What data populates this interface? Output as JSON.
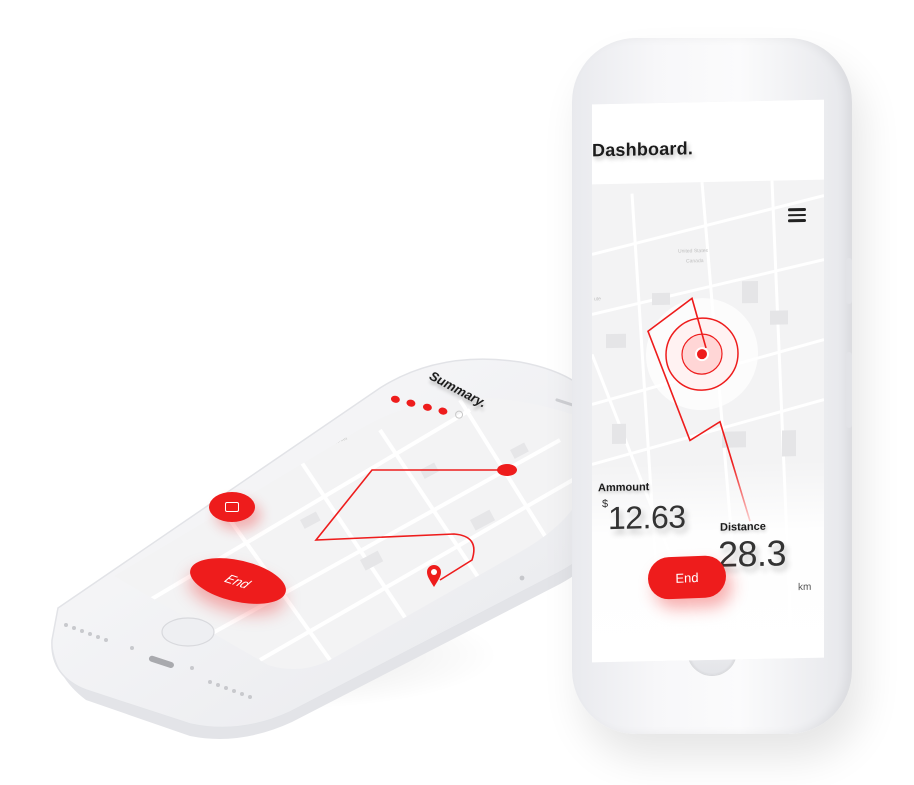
{
  "left_phone": {
    "screen_title": "Summary.",
    "progress_dots": {
      "filled": 4,
      "total": 5
    },
    "chat_button_icon": "chat-icon",
    "end_button_label": "End",
    "map_pin_icon": "map-pin-icon"
  },
  "right_phone": {
    "screen_title": "Dashboard.",
    "menu_icon": "hamburger-menu-icon",
    "amount": {
      "label": "Ammount",
      "currency": "$",
      "value": "12.63"
    },
    "distance": {
      "label": "Distance",
      "value": "28.3",
      "unit": "km"
    },
    "end_button_label": "End",
    "location_icon": "location-target-icon"
  },
  "colors": {
    "accent": "#ee1c1c",
    "map_background": "#f3f3f4",
    "map_roads": "#ffffff",
    "device_body": "#f4f4f6",
    "text": "#1c1c1c"
  }
}
